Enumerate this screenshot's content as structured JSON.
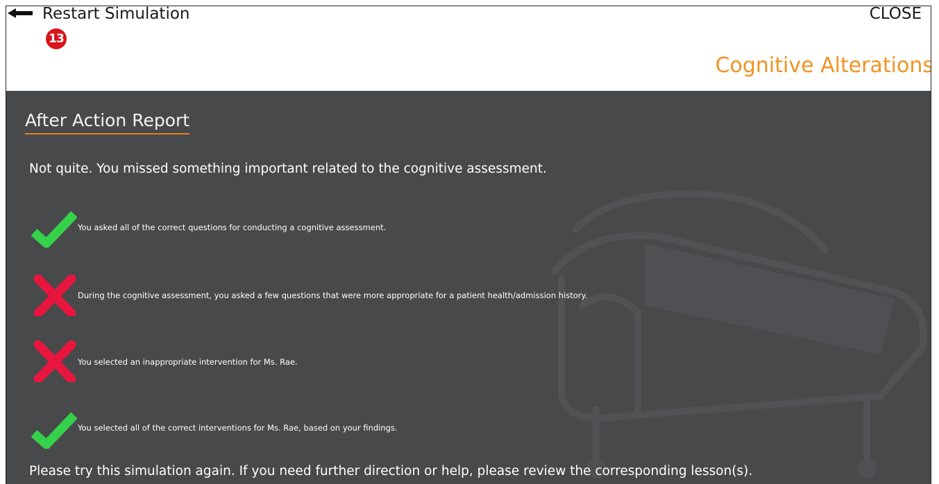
{
  "header": {
    "restart_label": "Restart Simulation",
    "step_badge": "13",
    "close_label": "CLOSE",
    "module_title": "Cognitive Alterations"
  },
  "report": {
    "title": "After Action Report",
    "intro": "Not quite. You missed something important related to the cognitive assessment.",
    "items": [
      {
        "status": "correct",
        "icon": "green-check-icon",
        "text": "You asked all of the correct questions for conducting a cognitive assessment."
      },
      {
        "status": "incorrect",
        "icon": "red-x-icon",
        "text": "During the cognitive assessment, you asked a few questions that were more appropriate for a patient health/admission history."
      },
      {
        "status": "incorrect",
        "icon": "red-x-icon",
        "text": "You selected an inappropriate intervention for Ms. Rae."
      },
      {
        "status": "correct",
        "icon": "green-check-icon",
        "text": "You selected all of the correct interventions for Ms. Rae, based on your findings."
      }
    ],
    "footer": "Please try this simulation again. If you need further direction or help, please review the corresponding lesson(s)."
  },
  "colors": {
    "accent": "#f39221",
    "panel_bg": "#48494b",
    "check": "#35d14a",
    "cross": "#e8163f",
    "badge": "#d9141b"
  }
}
